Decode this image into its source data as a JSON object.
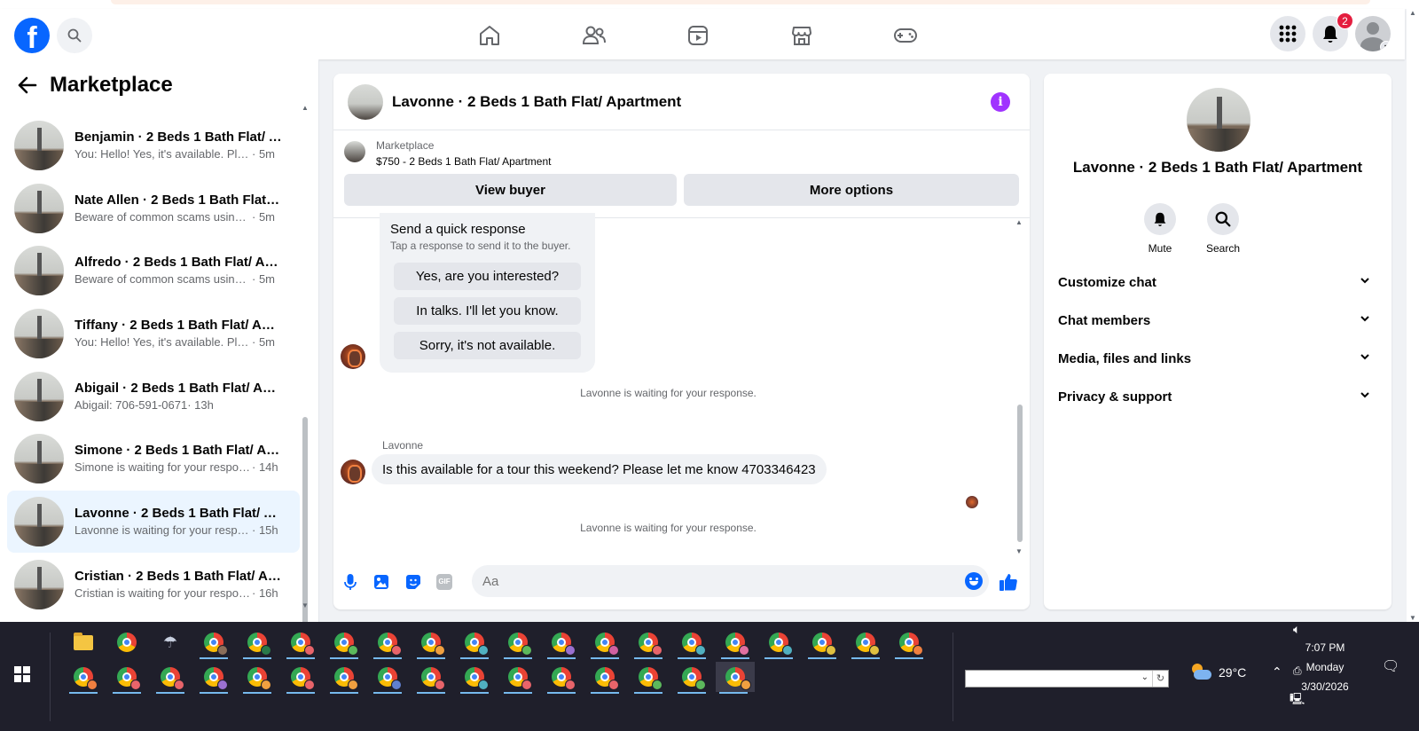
{
  "topnav": {
    "logo": "f",
    "notifications_count": "2"
  },
  "sidebar": {
    "title": "Marketplace",
    "conversations": [
      {
        "name": "Benjamin · 2 Beds 1 Bath Flat/ A...",
        "preview": "You: Hello! Yes, it's available. Pleas...",
        "time": " · 5m",
        "active": false
      },
      {
        "name": "Nate Allen · 2 Beds 1 Bath Flat/ ...",
        "preview": "Beware of common scams using p...",
        "time": " · 5m",
        "active": false
      },
      {
        "name": "Alfredo · 2 Beds 1 Bath Flat/ Apa...",
        "preview": "Beware of common scams using p...",
        "time": " · 5m",
        "active": false
      },
      {
        "name": "Tiffany · 2 Beds 1 Bath Flat/ Apa...",
        "preview": "You: Hello! Yes, it's available. Pleas...",
        "time": " · 5m",
        "active": false
      },
      {
        "name": "Abigail · 2 Beds 1 Bath Flat/ Apa...",
        "preview": "Abigail: 706-591-0671",
        "time": " · 13h",
        "active": false
      },
      {
        "name": "Simone · 2 Beds 1 Bath Flat/ Apa...",
        "preview": "Simone is waiting for your respon...",
        "time": " · 14h",
        "active": false
      },
      {
        "name": "Lavonne · 2 Beds 1 Bath Flat/ Ap...",
        "preview": "Lavonne is waiting for your respo...",
        "time": " · 15h",
        "active": true
      },
      {
        "name": "Cristian · 2 Beds 1 Bath Flat/ Apa...",
        "preview": "Cristian is waiting for your respon...",
        "time": " · 16h",
        "active": false
      }
    ]
  },
  "chat": {
    "title": "Lavonne · 2 Beds 1 Bath Flat/ Apartment",
    "listing": {
      "source": "Marketplace",
      "price_title": "$750 - 2 Beds 1 Bath Flat/ Apartment",
      "view_buyer": "View buyer",
      "more_options": "More options"
    },
    "quick_response": {
      "title": "Send a quick response",
      "subtitle": "Tap a response to send it to the buyer.",
      "options": [
        "Yes, are you interested?",
        "In talks. I'll let you know.",
        "Sorry, it's not available."
      ]
    },
    "system_message_1": "Lavonne is waiting for your response.",
    "sender_name": "Lavonne",
    "message": "Is this available for a tour this weekend? Please let me know 4703346423",
    "system_message_2": "Lavonne is waiting for your response.",
    "composer_placeholder": "Aa",
    "gif_label": "GIF"
  },
  "info_panel": {
    "name": "Lavonne · 2 Beds 1 Bath Flat/ Apartment",
    "actions": [
      {
        "label": "Mute",
        "icon": "bell-icon"
      },
      {
        "label": "Search",
        "icon": "search-icon"
      }
    ],
    "sections": [
      "Customize chat",
      "Chat members",
      "Media, files and links",
      "Privacy & support"
    ]
  },
  "taskbar": {
    "weather": "29°C",
    "time": "7:07 PM",
    "day": "Monday",
    "date": "3/30/2026"
  },
  "colors": {
    "fb_blue": "#0866ff",
    "active_row": "#ebf5ff",
    "info_purple": "#a033ff",
    "notif_red": "#e41e3f",
    "taskbar": "#1f1f2b"
  }
}
